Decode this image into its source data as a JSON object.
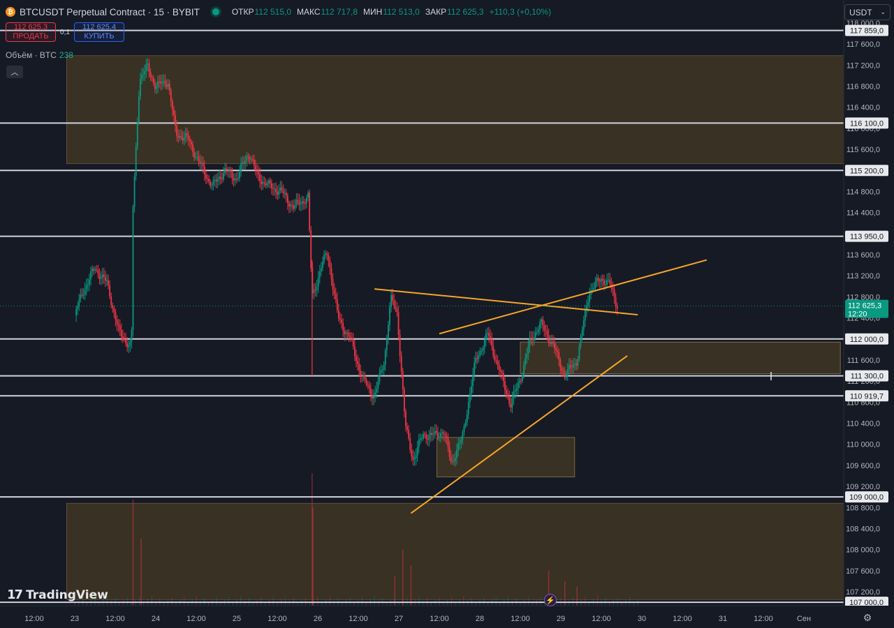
{
  "header": {
    "symbol_title": "BTCUSDT Perpetual Contract · 15 · BYBIT",
    "open_label": "ОТКР",
    "open_value": "112 515,0",
    "high_label": "МАКС",
    "high_value": "112 717,8",
    "low_label": "МИН",
    "low_value": "112 513,0",
    "close_label": "ЗАКР",
    "close_value": "112 625,3",
    "change": "+110,3 (+0,10%)"
  },
  "trade": {
    "sell_price": "112 625,3",
    "sell_label": "ПРОДАТЬ",
    "spread": "0,1",
    "buy_price": "112 625,4",
    "buy_label": "КУПИТЬ"
  },
  "volume_legend": {
    "label": "Объём · BTC",
    "value": "238"
  },
  "currency": {
    "selected": "USDT"
  },
  "branding": {
    "logo_text": "TradingView"
  },
  "colors": {
    "background": "#161a25",
    "up": "#089981",
    "down": "#f23645",
    "zone_fill": "#3f3623",
    "trendline": "#f7a62a",
    "level_line": "#d1d4dc"
  },
  "chart_data": {
    "type": "candlestick",
    "ylim": [
      106900,
      118300
    ],
    "y_ticks": [
      "118 000,0",
      "117 600,0",
      "117 200,0",
      "116 800,0",
      "116 400,0",
      "116 000,0",
      "115 600,0",
      "115 200,0",
      "114 800,0",
      "114 400,0",
      "114 000,0",
      "113 600,0",
      "113 200,0",
      "112 800,0",
      "112 400,0",
      "112 000,0",
      "111 600,0",
      "111 200,0",
      "110 800,0",
      "110 400,0",
      "110 000,0",
      "109 600,0",
      "109 200,0",
      "108 800,0",
      "108 400,0",
      "108 000,0",
      "107 600,0",
      "107 200,0"
    ],
    "x_ticks": [
      "12:00",
      "23",
      "12:00",
      "24",
      "12:00",
      "25",
      "12:00",
      "26",
      "12:00",
      "27",
      "12:00",
      "28",
      "12:00",
      "29",
      "12:00",
      "30",
      "12:00",
      "31",
      "12:00",
      "Сен"
    ],
    "series_path": [
      [
        0.0,
        112450
      ],
      [
        0.1,
        112900
      ],
      [
        0.25,
        113350
      ],
      [
        0.4,
        113050
      ],
      [
        0.55,
        112100
      ],
      [
        0.7,
        111850
      ],
      [
        0.72,
        114500
      ],
      [
        0.8,
        116950
      ],
      [
        0.9,
        117150
      ],
      [
        1.0,
        116800
      ],
      [
        1.15,
        116900
      ],
      [
        1.25,
        115900
      ],
      [
        1.4,
        115800
      ],
      [
        1.55,
        115300
      ],
      [
        1.7,
        114900
      ],
      [
        1.85,
        115200
      ],
      [
        2.0,
        115050
      ],
      [
        2.15,
        115550
      ],
      [
        2.25,
        115100
      ],
      [
        2.4,
        114900
      ],
      [
        2.55,
        114800
      ],
      [
        2.7,
        114500
      ],
      [
        2.88,
        114700
      ],
      [
        2.93,
        112800
      ],
      [
        3.05,
        113400
      ],
      [
        3.12,
        113650
      ],
      [
        3.25,
        112400
      ],
      [
        3.4,
        112000
      ],
      [
        3.55,
        111250
      ],
      [
        3.7,
        110900
      ],
      [
        3.82,
        111600
      ],
      [
        3.9,
        112750
      ],
      [
        3.98,
        112500
      ],
      [
        4.08,
        110350
      ],
      [
        4.18,
        109700
      ],
      [
        4.3,
        110200
      ],
      [
        4.4,
        110150
      ],
      [
        4.55,
        110250
      ],
      [
        4.65,
        109650
      ],
      [
        4.78,
        110100
      ],
      [
        4.95,
        111600
      ],
      [
        5.1,
        112100
      ],
      [
        5.2,
        111600
      ],
      [
        5.38,
        110750
      ],
      [
        5.5,
        111250
      ],
      [
        5.62,
        111950
      ],
      [
        5.75,
        112300
      ],
      [
        5.9,
        111900
      ],
      [
        6.05,
        111300
      ],
      [
        6.2,
        111600
      ],
      [
        6.35,
        112900
      ],
      [
        6.5,
        113150
      ],
      [
        6.6,
        113050
      ],
      [
        6.7,
        112625
      ]
    ],
    "volume_spikes": [
      [
        0.72,
        108950
      ],
      [
        0.82,
        108200
      ],
      [
        2.93,
        109450
      ],
      [
        2.94,
        108800
      ],
      [
        3.95,
        107500
      ],
      [
        4.05,
        108000
      ],
      [
        4.15,
        107700
      ],
      [
        5.85,
        107600
      ],
      [
        6.05,
        107400
      ],
      [
        6.2,
        107300
      ]
    ],
    "last_price": {
      "label": "112 625,3",
      "countdown": "12:20",
      "value": 112625.3
    },
    "levels": [
      {
        "value": 117859,
        "label": "117 859,0"
      },
      {
        "value": 116100,
        "label": "116 100,0"
      },
      {
        "value": 115200,
        "label": "115 200,0"
      },
      {
        "value": 113950,
        "label": "113 950,0"
      },
      {
        "value": 112000,
        "label": "112 000,0"
      },
      {
        "value": 111300,
        "label": "111 300,0"
      },
      {
        "value": 110919.7,
        "label": "110 919,7"
      },
      {
        "value": 109000,
        "label": "109 000,0"
      },
      {
        "value": 107000,
        "label": "107 000,0"
      }
    ],
    "zones": [
      {
        "t0": -0.1,
        "t1": 9.7,
        "p_top": 117380,
        "p_bot": 115330
      },
      {
        "t0": -0.1,
        "t1": 9.7,
        "p_top": 108880,
        "p_bot": 107050
      },
      {
        "t0": 4.47,
        "t1": 6.17,
        "p_top": 110130,
        "p_bot": 109380
      },
      {
        "t0": 5.5,
        "t1": 9.45,
        "p_top": 111940,
        "p_bot": 111340
      }
    ],
    "trendlines": [
      {
        "t0": 3.7,
        "p0": 112950,
        "t1": 6.95,
        "p1": 112460
      },
      {
        "t0": 4.5,
        "p0": 112100,
        "t1": 7.8,
        "p1": 113500
      },
      {
        "t0": 4.15,
        "p0": 108690,
        "t1": 6.82,
        "p1": 111680
      }
    ]
  }
}
